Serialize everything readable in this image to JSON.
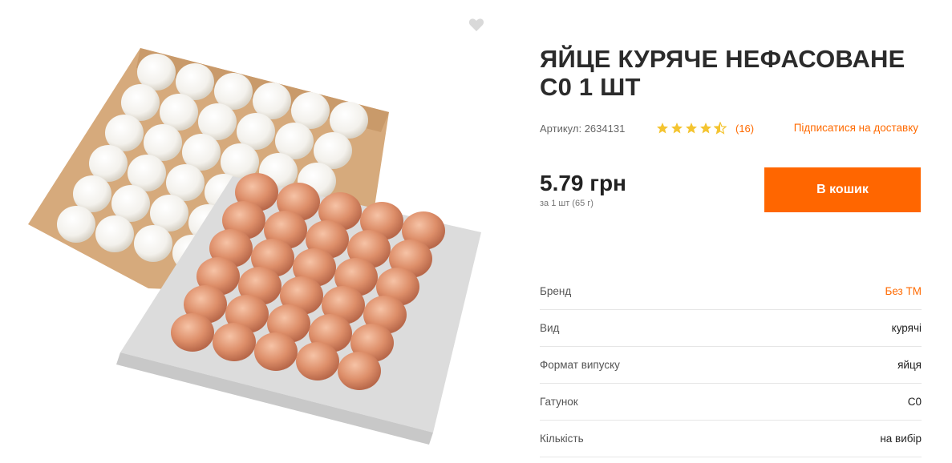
{
  "product": {
    "title": "ЯЙЦЕ КУРЯЧЕ НЕФАСОВАНЕ С0 1 ШТ",
    "sku_label": "Артикул:",
    "sku_value": "2634131",
    "rating": 4.5,
    "reviews_count": "(16)",
    "subscribe_label": "Підписатися на доставку",
    "price": "5.79 грн",
    "unit_note": "за 1 шт (65 г)",
    "add_to_cart_label": "В кошик"
  },
  "specs": [
    {
      "name": "Бренд",
      "value": "Без ТМ"
    },
    {
      "name": "Вид",
      "value": "курячі"
    },
    {
      "name": "Формат випуску",
      "value": "яйця"
    },
    {
      "name": "Гатунок",
      "value": "С0"
    },
    {
      "name": "Кількість",
      "value": "на вибір"
    }
  ],
  "colors": {
    "accent": "#ff6600",
    "star": "#f4c430",
    "heart": "#d9d9d9"
  },
  "icons": {
    "favorite": "heart-icon",
    "star": "star-icon"
  }
}
